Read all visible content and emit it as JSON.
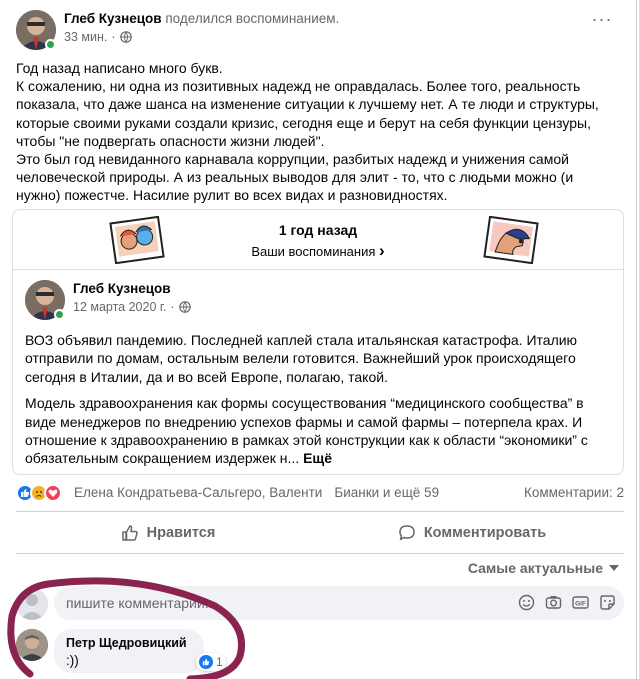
{
  "post": {
    "author": "Глеб Кузнецов",
    "action": "поделился воспоминанием.",
    "time": "33 мин.",
    "more": "···",
    "text": [
      "Год назад написано много букв.",
      "К сожалению, ни одна из позитивных надежд не оправдалась. Более того, реальность показала, что даже шанса на изменение ситуации к лучшему нет. А те люди и структуры, которые своими руками создали кризис, сегодня еще и берут на себя функции цензуры, чтобы \"не подвергать опасности жизни людей\".",
      "Это был год невиданного карнавала коррупции, разбитых надежд и унижения самой человеческой природы. А из реальных выводов для элит - то, что с людьми можно (и нужно) пожестче. Насилие рулит во всех видах и разновидностях."
    ]
  },
  "memory": {
    "title": "1 год назад",
    "link": "Ваши воспоминания",
    "chevron": "›",
    "original": {
      "author": "Глеб Кузнецов",
      "date": "12 марта 2020 г.",
      "para1": "ВОЗ объявил пандемию. Последней каплей стала итальянская катастрофа. Италию отправили по домам, остальным велели готовится. Важнейший урок происходящего сегодня в Италии, да и во всей Европе, полагаю, такой.",
      "para2": "Модель здравоохранения как формы сосуществования “медицинского сообщества” в виде менеджеров по внедрению успехов фармы и самой фармы – потерпела крах. И отношение к здравоохранению в рамках этой конструкции как к области “экономики” с обязательным сокращением издержек н...",
      "see_more": "Ещё"
    }
  },
  "reactions": {
    "names_a": "Елена Кондратьева-Сальгеро, Валенти",
    "names_b": "Бианки и ещё 59",
    "comments": "Комментарии: 2"
  },
  "actions": {
    "like": "Нравится",
    "comment": "Комментировать"
  },
  "sort": {
    "label": "Самые актуальные"
  },
  "composer": {
    "placeholder": "пишите комментарий..."
  },
  "comment": {
    "author": "Петр Щедровицкий",
    "text": ":))",
    "reaction_count": "1"
  },
  "colors": {
    "accent": "#1877f2",
    "secondary_text": "#65676b",
    "online": "#31a24c",
    "annotation": "#8b2350"
  }
}
